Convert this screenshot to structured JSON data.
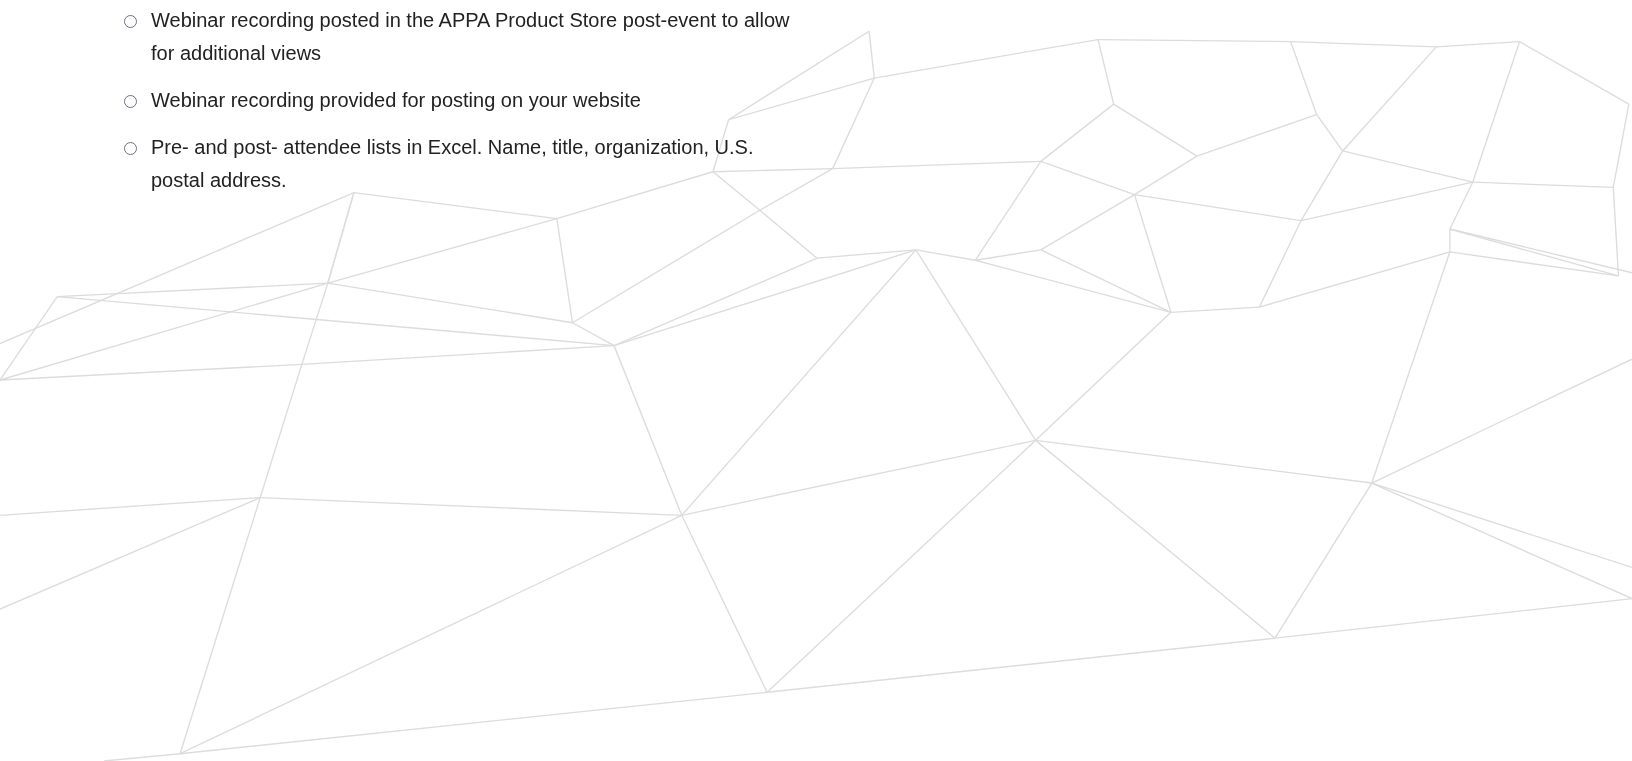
{
  "benefits": [
    {
      "text": "Webinar recording posted in the APPA Product Store post-event to allow for additional views"
    },
    {
      "text": "Webinar recording provided for posting on your website"
    },
    {
      "text": "Pre- and post- attendee lists in Excel. Name, title, organization, U.S. postal address."
    }
  ]
}
